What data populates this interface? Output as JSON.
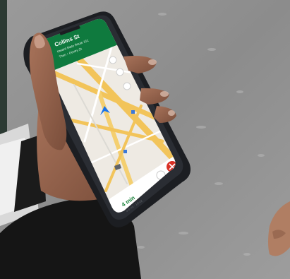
{
  "photo": {
    "subject": "hand-holding-smartphone-showing-map-navigation",
    "colors": {
      "pavement": "#8f8f8f",
      "pavement_light": "#a9a9a9",
      "phone_case": "#1c1e22",
      "sleeve": "#141414",
      "skin": "#9a6a52",
      "skin_shadow": "#6e4736",
      "map_bg": "#eeeae3",
      "road_major": "#f2c45a",
      "nav_header": "#0f7a3e",
      "stop_button": "#d93025"
    }
  },
  "phone_screen": {
    "header_street": "Collins St",
    "header_subtitle": "toward State Route 151",
    "header_then": "Then ↑ Gentry St",
    "eta_time": "4 min",
    "eta_detail": "0.6 mi · 10:42",
    "icons": [
      "mic-icon",
      "compass-icon",
      "sound-icon",
      "navigation-arrow-icon",
      "route-options-icon",
      "close-navigation-icon"
    ]
  }
}
